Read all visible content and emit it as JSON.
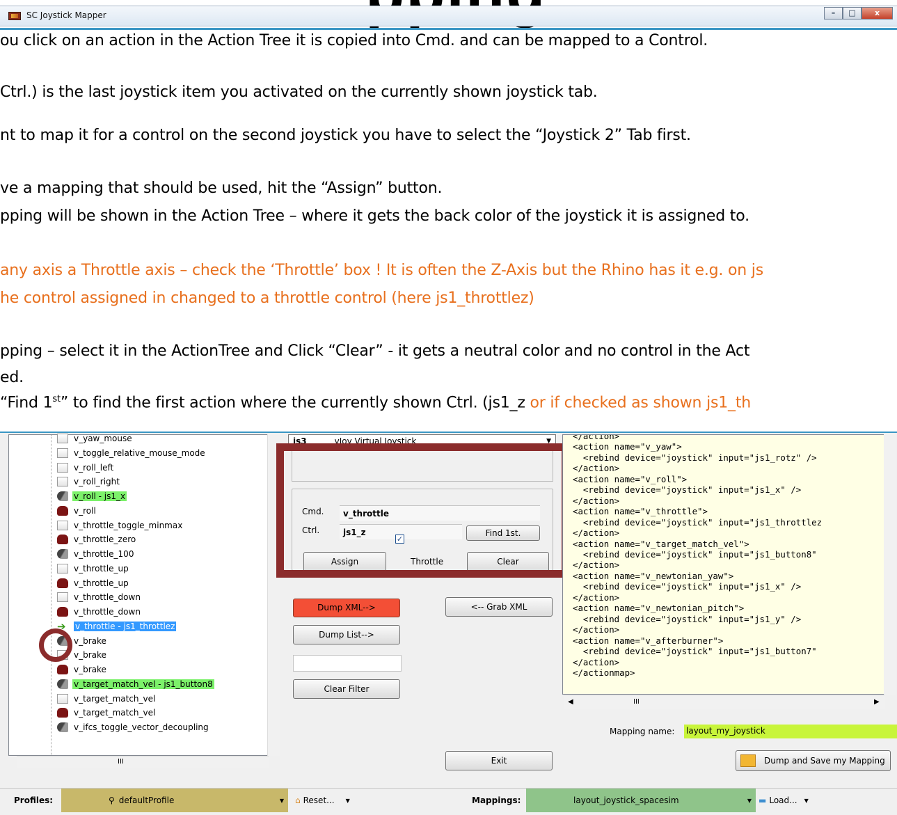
{
  "heading": "pping",
  "window": {
    "title": "SC Joystick Mapper",
    "buttons": {
      "minimize": "–",
      "maximize": "□",
      "close": "x"
    }
  },
  "instructions": [
    {
      "text": "ou click on an action in the Action Tree it is copied into Cmd. and can be mapped to a Control.",
      "color": "black"
    },
    {
      "text": "Ctrl.) is the last joystick item you activated on the currently shown joystick tab.",
      "color": "black"
    },
    {
      "text": "nt to map it for a control on the second joystick you have to select the “Joystick 2” Tab first.",
      "color": "black"
    },
    {
      "text": "ve a mapping that should be used, hit the “Assign” button.",
      "color": "black"
    },
    {
      "text": "pping will be shown in the Action Tree – where it gets the back color of the joystick it is assigned to.",
      "color": "black"
    },
    {
      "text": "any axis a Throttle axis – check the ‘Throttle’ box ! It is often the Z-Axis but the Rhino has it e.g. on js",
      "color": "orange"
    },
    {
      "text": "he control assigned in changed to a throttle control (here js1_throttlez)",
      "color": "orange"
    },
    {
      "text": "pping – select it in the ActionTree and Click “Clear” - it gets a neutral color and no control in the Act",
      "color": "black"
    },
    {
      "text": "ed.",
      "color": "black"
    }
  ],
  "find_line": {
    "prefix": "“Find 1",
    "sup": "st",
    "middle": "” to find the first action where the currently shown Ctrl. (js1_z ",
    "orange": "or if checked as shown js1_th"
  },
  "tree": {
    "items": [
      {
        "label": "v_yaw_mouse",
        "icon": "plain",
        "style": ""
      },
      {
        "label": "v_toggle_relative_mouse_mode",
        "icon": "plain",
        "style": ""
      },
      {
        "label": "v_roll_left",
        "icon": "plain",
        "style": ""
      },
      {
        "label": "v_roll_right",
        "icon": "plain",
        "style": ""
      },
      {
        "label": "v_roll - js1_x",
        "icon": "stick",
        "style": "green"
      },
      {
        "label": "v_roll",
        "icon": "pad",
        "style": ""
      },
      {
        "label": "v_throttle_toggle_minmax",
        "icon": "plain",
        "style": ""
      },
      {
        "label": "v_throttle_zero",
        "icon": "pad",
        "style": ""
      },
      {
        "label": "v_throttle_100",
        "icon": "stick",
        "style": ""
      },
      {
        "label": "v_throttle_up",
        "icon": "plain",
        "style": ""
      },
      {
        "label": "v_throttle_up",
        "icon": "pad",
        "style": ""
      },
      {
        "label": "v_throttle_down",
        "icon": "plain",
        "style": ""
      },
      {
        "label": "v_throttle_down",
        "icon": "pad",
        "style": ""
      },
      {
        "label": "v_throttle - js1_throttlez",
        "icon": "arrow",
        "style": "sel"
      },
      {
        "label": "v_brake",
        "icon": "stick",
        "style": ""
      },
      {
        "label": "v_brake",
        "icon": "plain",
        "style": ""
      },
      {
        "label": "v_brake",
        "icon": "pad",
        "style": ""
      },
      {
        "label": "v_target_match_vel - js1_button8",
        "icon": "stick",
        "style": "green"
      },
      {
        "label": "v_target_match_vel",
        "icon": "plain",
        "style": ""
      },
      {
        "label": "v_target_match_vel",
        "icon": "pad",
        "style": ""
      },
      {
        "label": "v_ifcs_toggle_vector_decoupling",
        "icon": "stick",
        "style": ""
      }
    ],
    "scroll_thumb": "III"
  },
  "joystick": {
    "code": "js3",
    "name": "vJoy Virtual Joystick"
  },
  "mapper": {
    "cmd_label": "Cmd.",
    "cmd_value": "v_throttle",
    "ctrl_label": "Ctrl.",
    "ctrl_value": "js1_z",
    "find_button": "Find 1st.",
    "assign_button": "Assign",
    "throttle_label": "Throttle",
    "throttle_checked": true,
    "clear_button": "Clear"
  },
  "buttons": {
    "dump_xml": "Dump XML-->",
    "grab_xml": "<-- Grab XML",
    "dump_list": "Dump List-->",
    "clear_filter": "Clear Filter",
    "exit": "Exit",
    "dump_save": "Dump and Save my Mapping"
  },
  "xml_text": "</action>\n<action name=\"v_yaw\">\n  <rebind device=\"joystick\" input=\"js1_rotz\" />\n</action>\n<action name=\"v_roll\">\n  <rebind device=\"joystick\" input=\"js1_x\" />\n</action>\n<action name=\"v_throttle\">\n  <rebind device=\"joystick\" input=\"js1_throttlez\n</action>\n<action name=\"v_target_match_vel\">\n  <rebind device=\"joystick\" input=\"js1_button8\"\n</action>\n<action name=\"v_newtonian_yaw\">\n  <rebind device=\"joystick\" input=\"js1_x\" />\n</action>\n<action name=\"v_newtonian_pitch\">\n  <rebind device=\"joystick\" input=\"js1_y\" />\n</action>\n<action name=\"v_afterburner\">\n  <rebind device=\"joystick\" input=\"js1_button7\"\n</action>\n</actionmap>",
  "xml_scroll_thumb": "III",
  "mapping_name": {
    "label": "Mapping name:",
    "value": "layout_my_joystick"
  },
  "toolbar": {
    "profiles_label": "Profiles:",
    "profile_value": "defaultProfile",
    "reset_label": "Reset...",
    "mappings_label": "Mappings:",
    "mapping_value": "layout_joystick_spacesim",
    "load_label": "Load..."
  },
  "colors": {
    "accent_line": "#3a96c4",
    "annotation_red": "#8b2c2c",
    "orange_text": "#e8701e",
    "green_highlight": "#7cf16a",
    "selection": "#3399ff",
    "dump_xml_red": "#f34f36",
    "mapping_name_bg": "#c8f53a",
    "xml_bg": "#ffffe5"
  }
}
